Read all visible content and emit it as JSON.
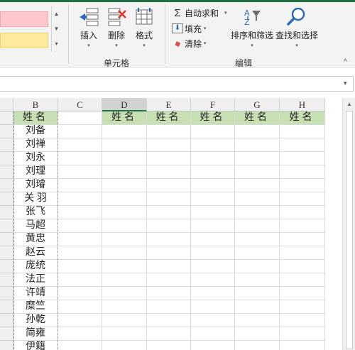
{
  "colors": {
    "accent_green": "#217346",
    "header_fill": "#c6e0b4",
    "style_bad": "#ffc7ce",
    "style_neutral": "#ffeb9c"
  },
  "ribbon": {
    "cells_group": {
      "label": "单元格",
      "insert": {
        "label": "插入",
        "icon": "insert-cells-icon"
      },
      "delete": {
        "label": "删除",
        "icon": "delete-cells-icon"
      },
      "format": {
        "label": "格式",
        "icon": "format-cells-icon"
      }
    },
    "editing_group": {
      "label": "编辑",
      "autosum": {
        "label": "自动求和",
        "icon": "sigma-icon",
        "glyph": "Σ"
      },
      "fill": {
        "label": "填充",
        "icon": "fill-down-icon",
        "glyph": "⬇"
      },
      "clear": {
        "label": "清除",
        "icon": "eraser-icon",
        "glyph": "◆"
      },
      "sort_filter": {
        "label": "排序和筛选",
        "icon": "sort-filter-icon"
      },
      "find_select": {
        "label": "查找和选择",
        "icon": "magnifier-icon"
      }
    },
    "dropdown_caret": "▾",
    "collapse_caret": "^"
  },
  "formula_bar": {
    "value": "",
    "dropdown": "▾"
  },
  "sheet": {
    "columns": [
      "B",
      "C",
      "D",
      "E",
      "F",
      "G",
      "H"
    ],
    "header_text": "姓名",
    "names": [
      "刘备",
      "刘禅",
      "刘永",
      "刘理",
      "刘璿",
      "关 羽",
      "张飞",
      "马超",
      "黄忠",
      "赵云",
      "庞统",
      "法正",
      "许靖",
      "糜竺",
      "孙乾",
      "简雍",
      "伊籍"
    ]
  },
  "scrollbar": {
    "up": "▲",
    "down": "▼"
  }
}
